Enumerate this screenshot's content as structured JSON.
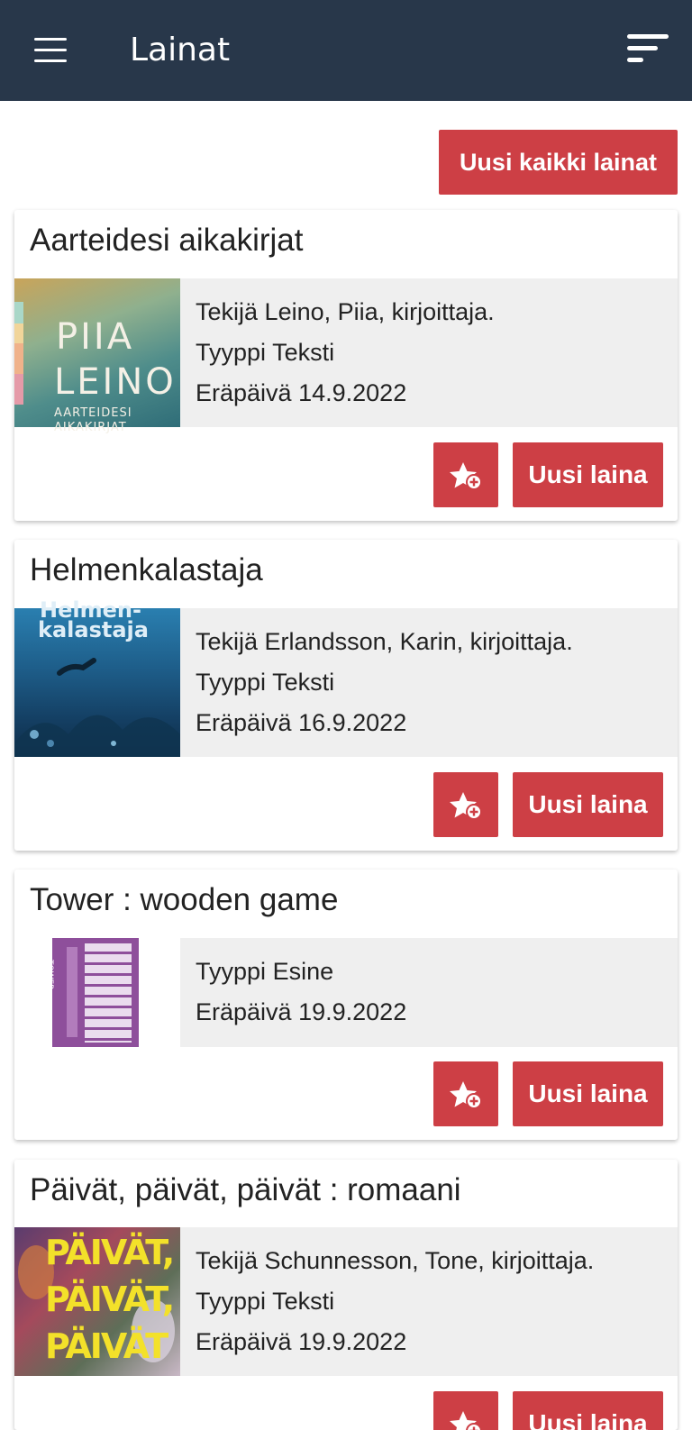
{
  "app": {
    "title": "Lainat",
    "menu_icon": "hamburger-menu-icon",
    "sort_icon": "sort-icon"
  },
  "actions": {
    "renew_all": "Uusi kaikki lainat"
  },
  "labels": {
    "author": "Tekijä",
    "type": "Tyyppi",
    "due": "Eräpäivä"
  },
  "loans": [
    {
      "title": "Aarteidesi aikakirjat",
      "author": "Leino, Piia, kirjoittaja.",
      "type": "Teksti",
      "due": "14.9.2022",
      "renew_label": "Uusi laina",
      "favorite_icon": "star-plus-icon",
      "cover_lines": [
        "PIIA",
        "LEINO",
        "AARTEIDESI",
        "AIKAKIRJAT"
      ]
    },
    {
      "title": "Helmenkalastaja",
      "author": "Erlandsson, Karin, kirjoittaja.",
      "type": "Teksti",
      "due": "16.9.2022",
      "renew_label": "Uusi laina",
      "favorite_icon": "star-plus-icon",
      "cover_lines": [
        "Helmen-",
        "kalastaja"
      ]
    },
    {
      "title": "Tower : wooden game",
      "author": null,
      "type": "Esine",
      "due": "19.9.2022",
      "renew_label": "Uusi laina",
      "favorite_icon": "star-plus-icon",
      "cover_lines": [
        "TOWER"
      ]
    },
    {
      "title": "Päivät, päivät, päivät : romaani",
      "author": "Schunnesson, Tone, kirjoittaja.",
      "type": "Teksti",
      "due": "19.9.2022",
      "renew_label": "Uusi laina",
      "favorite_icon": "star-plus-icon",
      "cover_lines": [
        "PÄIVÄT,",
        "PÄIVÄT,",
        "PÄIVÄT"
      ]
    }
  ],
  "colors": {
    "appbar": "#28374a",
    "accent": "#cd3f45",
    "info_bg": "#efefef"
  }
}
